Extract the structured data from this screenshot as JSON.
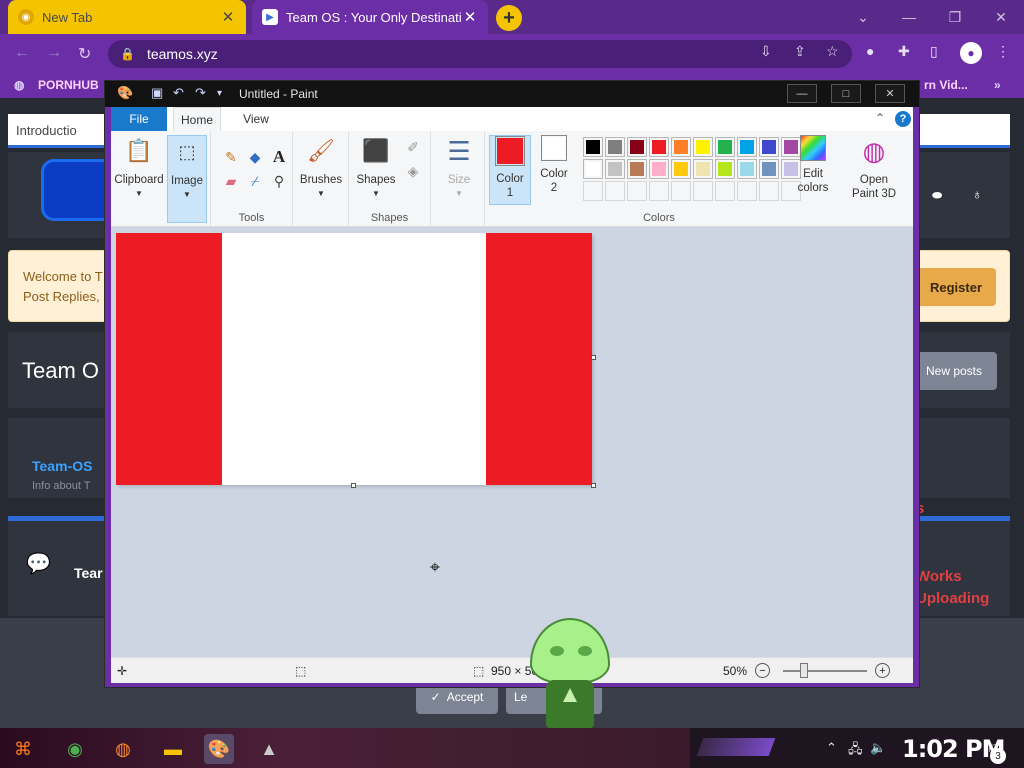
{
  "browser": {
    "tabs": [
      {
        "title": "New Tab",
        "active": false
      },
      {
        "title": "Team OS : Your Only Destinati",
        "active": true
      }
    ],
    "url": "teamos.xyz",
    "bookmarks": [
      {
        "label": "PORNHUB"
      },
      {
        "label": "rn Vid..."
      }
    ]
  },
  "page": {
    "tab_label": "Introductio",
    "welcome_line1": "Welcome to T",
    "welcome_line2": "Post Replies,",
    "register_label": "Register",
    "title": "Team O",
    "new_posts_label": "New posts",
    "forum_name": "Team-OS",
    "forum_desc": "Info about T",
    "section_name": "Tear",
    "red_texts": [
      "s",
      "Works",
      "Uploading"
    ],
    "accept_label": "Accept",
    "learn_label": "Le"
  },
  "paint": {
    "window_title": "Untitled - Paint",
    "ribbon_tabs": {
      "file": "File",
      "home": "Home",
      "view": "View"
    },
    "groups": {
      "clipboard": "Clipboard",
      "image": "Image",
      "tools": "Tools",
      "brushes": "Brushes",
      "shapes": "Shapes",
      "shapes_group": "Shapes",
      "size": "Size",
      "color1": "Color 1",
      "color2": "Color 2",
      "colors": "Colors",
      "edit_colors": "Edit colors",
      "open_paint3d": "Open Paint 3D"
    },
    "color1": "#ed1c24",
    "color2": "#ffffff",
    "palette_row1": [
      "#000000",
      "#7f7f7f",
      "#880015",
      "#ed1c24",
      "#ff7f27",
      "#fff200",
      "#22b14c",
      "#00a2e8",
      "#3f48cc",
      "#a349a4"
    ],
    "palette_row2": [
      "#ffffff",
      "#c3c3c3",
      "#b97a57",
      "#ffaec9",
      "#ffc90e",
      "#efe4b0",
      "#b5e61d",
      "#99d9ea",
      "#7092be",
      "#c8bfe7"
    ],
    "canvas": {
      "stripe_color": "#ed1c24",
      "background": "#ffffff"
    },
    "status": {
      "size": "950 × 50",
      "zoom": "50%"
    }
  },
  "taskbar": {
    "time": "1:02 PM",
    "notifications": "3"
  }
}
